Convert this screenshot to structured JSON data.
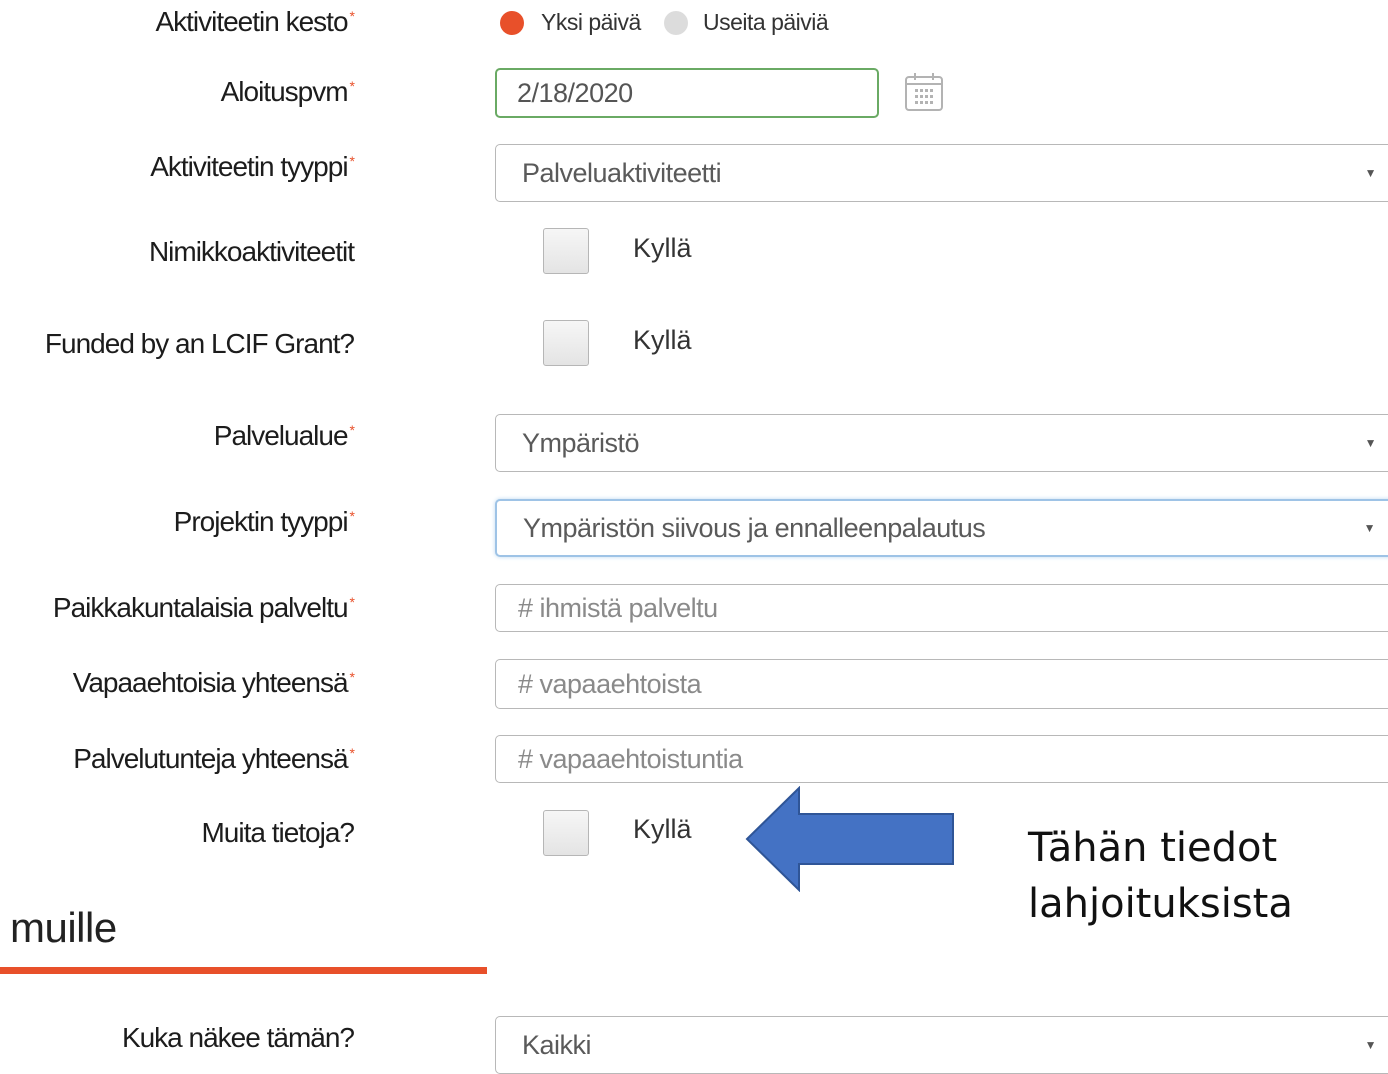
{
  "form": {
    "duration": {
      "label": "Aktiviteetin kesto",
      "required_mark": "*",
      "options": [
        "Yksi päivä",
        "Useita päiviä"
      ],
      "selected": "Yksi päivä"
    },
    "start_date": {
      "label": "Aloituspvm",
      "required_mark": "*",
      "value": "2/18/2020"
    },
    "activity_type": {
      "label": "Aktiviteetin tyyppi",
      "required_mark": "*",
      "value": "Palveluaktiviteetti"
    },
    "signature_activity": {
      "label": "Nimikkoaktiviteetit",
      "checkbox_label": "Kyllä",
      "checked": false
    },
    "lcif_grant": {
      "label": "Funded by an LCIF Grant?",
      "checkbox_label": "Kyllä",
      "checked": false
    },
    "service_area": {
      "label": "Palvelualue",
      "required_mark": "*",
      "value": "Ympäristö"
    },
    "project_type": {
      "label": "Projektin tyyppi",
      "required_mark": "*",
      "value": "Ympäristön siivous ja ennalleenpalautus"
    },
    "people_served": {
      "label": "Paikkakuntalaisia palveltu",
      "required_mark": "*",
      "placeholder": "# ihmistä palveltu"
    },
    "volunteers": {
      "label": "Vapaaehtoisia yhteensä",
      "required_mark": "*",
      "placeholder": "# vapaaehtoista"
    },
    "service_hours": {
      "label": "Palvelutunteja yhteensä",
      "required_mark": "*",
      "placeholder": "# vapaaehtoistuntia"
    },
    "more_info": {
      "label": "Muita tietoja?",
      "checkbox_label": "Kyllä",
      "checked": false
    }
  },
  "section": {
    "title": "muille"
  },
  "visibility": {
    "label": "Kuka näkee tämän?",
    "value": "Kaikki"
  },
  "annotation": {
    "line1": "Tähän tiedot",
    "line2": "lahjoituksista"
  },
  "colors": {
    "accent": "#e8502a",
    "arrow": "#4472c4",
    "date_border": "#6aaa64",
    "focus_border": "#9ec3e6"
  }
}
